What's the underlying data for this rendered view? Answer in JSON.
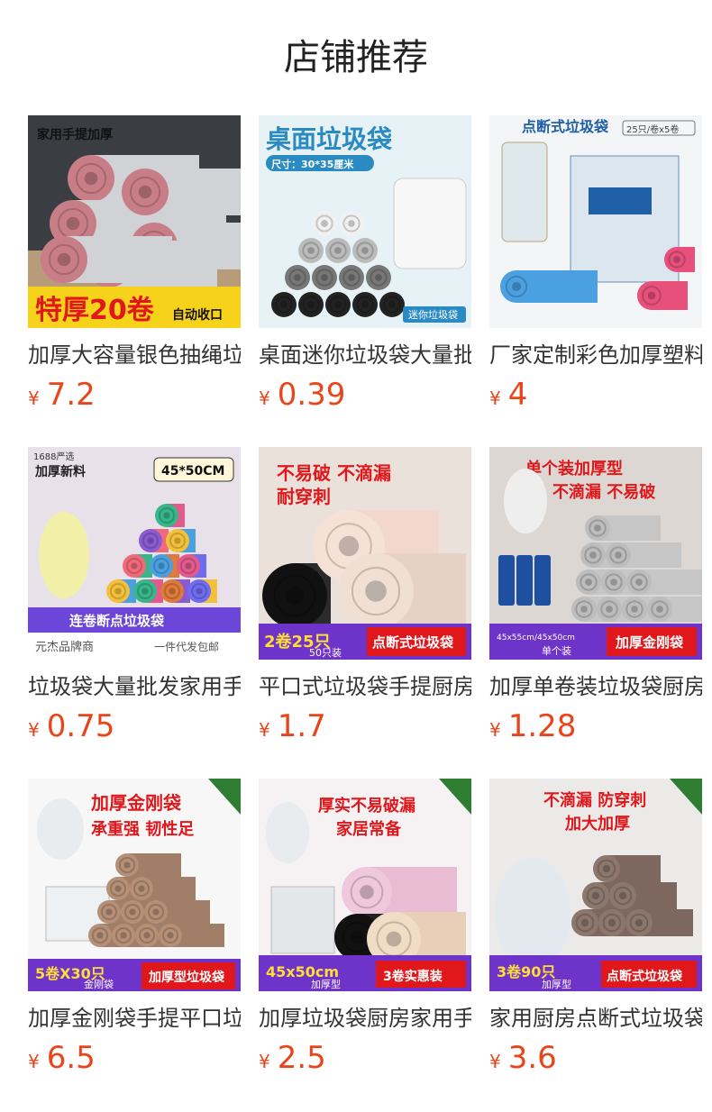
{
  "header": {
    "title": "店铺推荐"
  },
  "colors": {
    "price": "#e8461a"
  },
  "products": [
    {
      "name": "加厚大容量银色抽绳垃圾袋",
      "currency": "¥",
      "price": "7.2",
      "image": {
        "kind": "rolls-silver-red",
        "texts": [
          "家用手提加厚",
          "特厚20卷",
          "自动收口"
        ]
      }
    },
    {
      "name": "桌面迷你垃圾袋大量批发",
      "currency": "¥",
      "price": "0.39",
      "image": {
        "kind": "mini-desk",
        "texts": [
          "桌面垃圾袋",
          "尺寸：30*35厘米",
          "迷你垃圾袋"
        ]
      }
    },
    {
      "name": "厂家定制彩色加厚塑料袋",
      "currency": "¥",
      "price": "4",
      "image": {
        "kind": "colored-box",
        "texts": [
          "点断式垃圾袋",
          "25只/卷x5卷"
        ]
      }
    },
    {
      "name": "垃圾袋大量批发家用手提",
      "currency": "¥",
      "price": "0.75",
      "image": {
        "kind": "colorful-rolls",
        "texts": [
          "1688严选",
          "加厚新料",
          "45*50CM",
          "连卷断点垃圾袋",
          "元杰品牌商",
          "一件代发包邮"
        ]
      }
    },
    {
      "name": "平口式垃圾袋手提厨房用",
      "currency": "¥",
      "price": "1.7",
      "image": {
        "kind": "pink-black",
        "texts": [
          "不易破 不滴漏",
          "耐穿刺",
          "2卷25只",
          "50只装",
          "点断式垃圾袋"
        ]
      }
    },
    {
      "name": "加厚单卷装垃圾袋厨房用",
      "currency": "¥",
      "price": "1.28",
      "image": {
        "kind": "grey-stack",
        "texts": [
          "单个装加厚型",
          "不滴漏 不易破",
          "45x55cm/45x50cm",
          "单个装",
          "加厚金刚袋"
        ]
      }
    },
    {
      "name": "加厚金刚袋手提平口垃圾袋",
      "currency": "¥",
      "price": "6.5",
      "image": {
        "kind": "brown-rolls",
        "texts": [
          "加厚金刚袋",
          "承重强 韧性足",
          "5卷X30只",
          "金刚袋",
          "加厚型垃圾袋"
        ]
      }
    },
    {
      "name": "加厚垃圾袋厨房家用手提",
      "currency": "¥",
      "price": "2.5",
      "image": {
        "kind": "pink-beige",
        "texts": [
          "厚实不易破漏",
          "家居常备",
          "45x50cm",
          "加厚型",
          "3卷实惠装"
        ]
      }
    },
    {
      "name": "家用厨房点断式垃圾袋加厚",
      "currency": "¥",
      "price": "3.6",
      "image": {
        "kind": "brown-big-bag",
        "texts": [
          "不滴漏 防穿刺",
          "加大加厚",
          "3卷90只",
          "加厚型",
          "点断式垃圾袋"
        ]
      }
    }
  ]
}
